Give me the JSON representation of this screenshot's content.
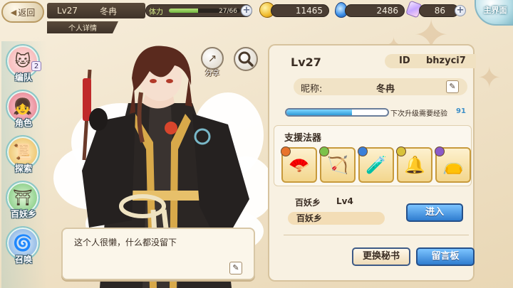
{
  "topbar": {
    "back_label": "返回",
    "player_level": "Lv27",
    "player_name": "冬冉",
    "sub_tab": "个人详情",
    "stamina_label": "体力",
    "stamina_value": "27/66",
    "stamina_fraction": 0.41,
    "coins": "11465",
    "drops": "2486",
    "gems": "86",
    "main_label": "主界面"
  },
  "nav": {
    "items": [
      {
        "label": "编队",
        "icon": "team-icon",
        "badge": "2"
      },
      {
        "label": "角色",
        "icon": "character-icon"
      },
      {
        "label": "探索",
        "icon": "explore-icon"
      },
      {
        "label": "百妖乡",
        "icon": "village-icon"
      },
      {
        "label": "召唤",
        "icon": "summon-icon"
      }
    ]
  },
  "actions": {
    "share_label": "分享"
  },
  "profile": {
    "level": "Lv27",
    "id_label": "ID",
    "id_value": "bhzyci7",
    "nickname_label": "昵称:",
    "nickname_value": "冬冉",
    "exp_label": "下次升级需要经验",
    "exp_value": "91",
    "exp_fraction": 0.65,
    "support_title": "支援法器",
    "support_items": [
      {
        "icon": "fan-icon",
        "element_color": "#e8732a"
      },
      {
        "icon": "bow-icon",
        "element_color": "#7cc24a"
      },
      {
        "icon": "potion-icon",
        "element_color": "#3a7fd8"
      },
      {
        "icon": "bell-icon",
        "element_color": "#d8c23a"
      },
      {
        "icon": "bag-icon",
        "element_color": "#8a5ac8"
      }
    ],
    "district_title": "百妖乡",
    "district_level": "Lv4",
    "district_name": "百妖乡",
    "enter_label": "进入",
    "change_secretary_label": "更换秘书",
    "message_board_label": "留言板"
  },
  "bubble": {
    "text": "这个人很懒，什么都没留下"
  }
}
